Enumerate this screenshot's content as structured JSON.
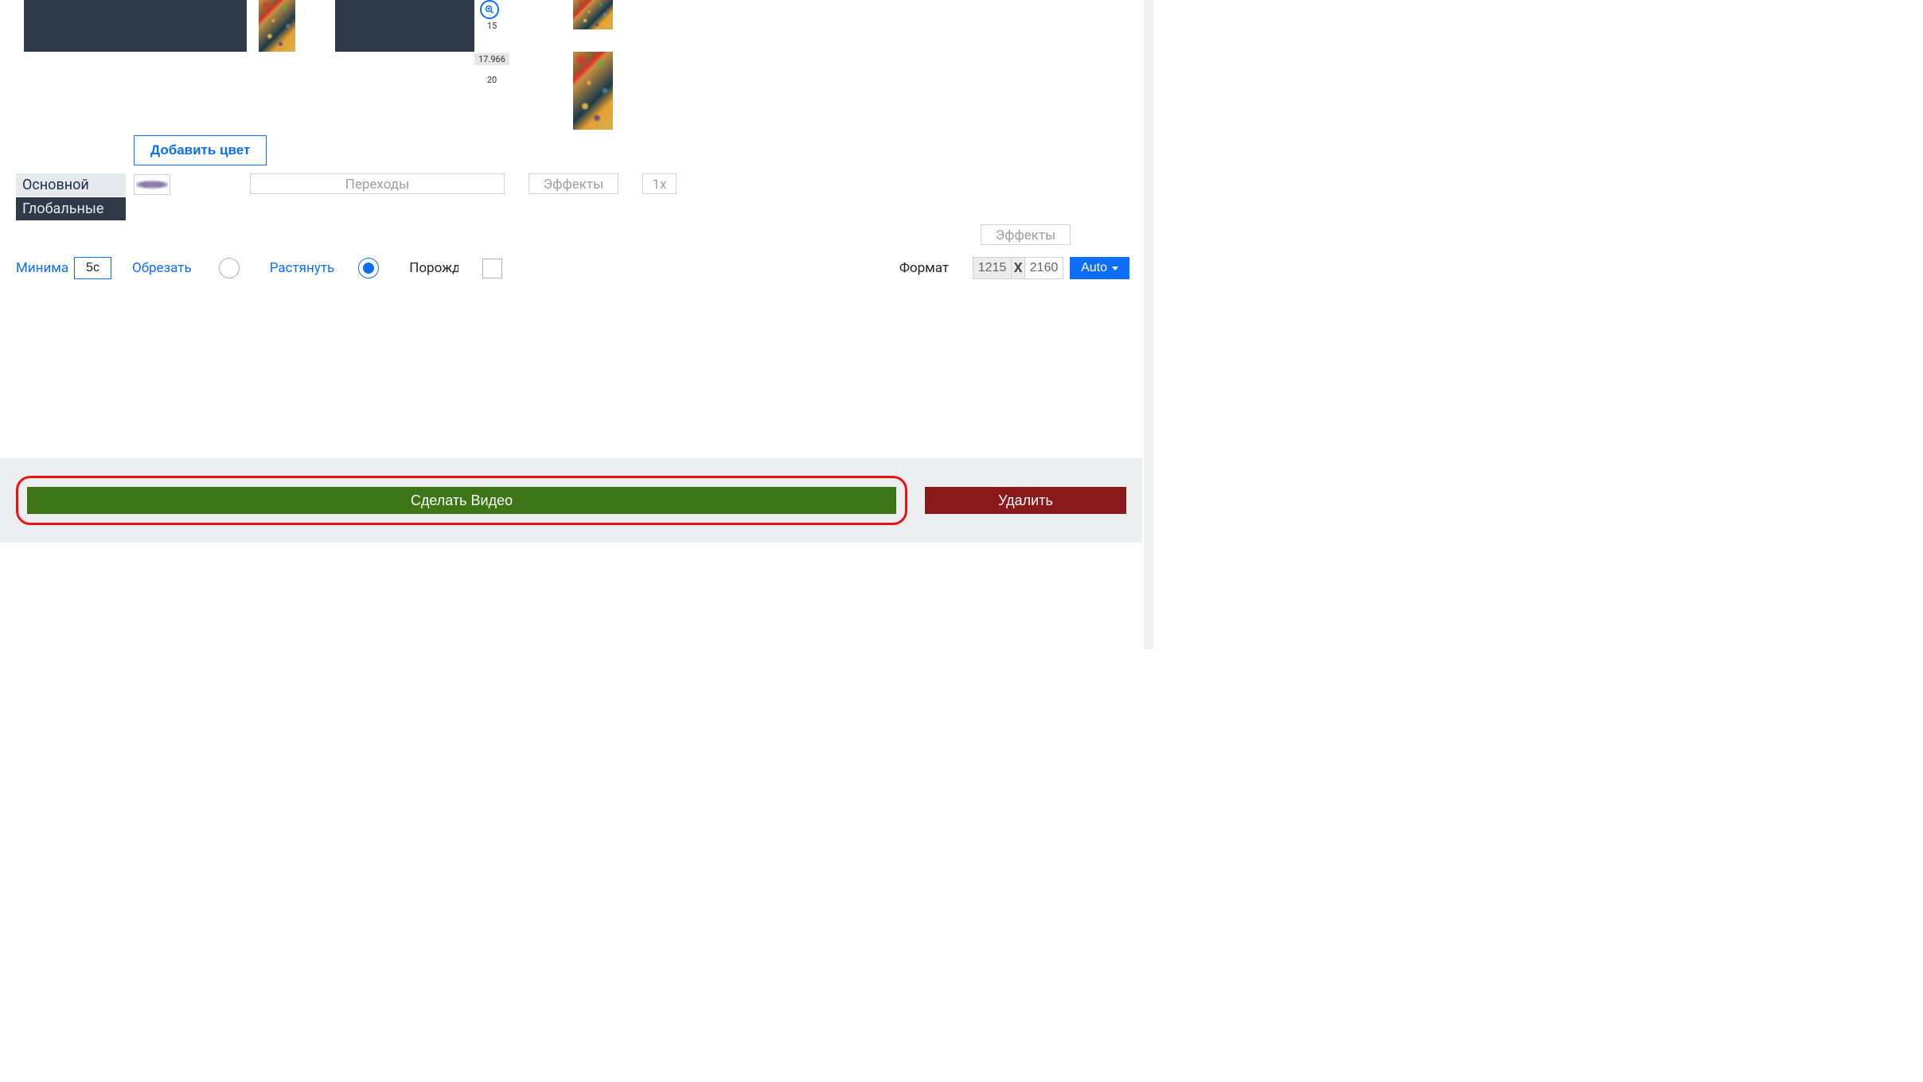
{
  "buttons": {
    "add_color": "Добавить цвет",
    "make_video": "Сделать Видео",
    "delete": "Удалить",
    "auto": "Auto"
  },
  "tabs": {
    "main": "Основной",
    "global": "Глобальные"
  },
  "selects": {
    "transitions": "Переходы",
    "effects": "Эффекты",
    "speed": "1x"
  },
  "fields": {
    "minimal_label": "Минималь",
    "minimal_value": "5с",
    "crop_label": "Обрезать",
    "stretch_label": "Растянуть",
    "generate_label": "Порождать",
    "format_label": "Формат",
    "width_value": "1215",
    "height_value": "2160",
    "x_separator": "X"
  },
  "ruler": {
    "tick_15": "15",
    "value_17": "17.966",
    "tick_20": "20"
  }
}
